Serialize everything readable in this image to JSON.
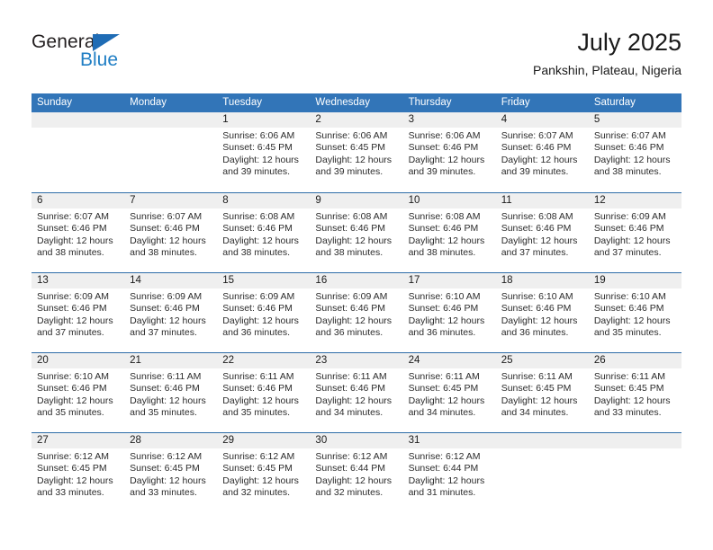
{
  "brand": {
    "name_top": "General",
    "name_bottom": "Blue",
    "accent_color": "#1f7ec4",
    "triangle_color": "#1f6cb5"
  },
  "header": {
    "title": "July 2025",
    "location": "Pankshin, Plateau, Nigeria"
  },
  "theme": {
    "header_row_bg": "#3275b8",
    "row_divider": "#2e6da8",
    "day_number_band": "#efefef",
    "text": "#2b2b2b"
  },
  "calendar": {
    "day_headers": [
      "Sunday",
      "Monday",
      "Tuesday",
      "Wednesday",
      "Thursday",
      "Friday",
      "Saturday"
    ],
    "weeks": [
      [
        {
          "day": "",
          "lines": []
        },
        {
          "day": "",
          "lines": []
        },
        {
          "day": "1",
          "lines": [
            "Sunrise: 6:06 AM",
            "Sunset: 6:45 PM",
            "Daylight: 12 hours",
            "and 39 minutes."
          ]
        },
        {
          "day": "2",
          "lines": [
            "Sunrise: 6:06 AM",
            "Sunset: 6:45 PM",
            "Daylight: 12 hours",
            "and 39 minutes."
          ]
        },
        {
          "day": "3",
          "lines": [
            "Sunrise: 6:06 AM",
            "Sunset: 6:46 PM",
            "Daylight: 12 hours",
            "and 39 minutes."
          ]
        },
        {
          "day": "4",
          "lines": [
            "Sunrise: 6:07 AM",
            "Sunset: 6:46 PM",
            "Daylight: 12 hours",
            "and 39 minutes."
          ]
        },
        {
          "day": "5",
          "lines": [
            "Sunrise: 6:07 AM",
            "Sunset: 6:46 PM",
            "Daylight: 12 hours",
            "and 38 minutes."
          ]
        }
      ],
      [
        {
          "day": "6",
          "lines": [
            "Sunrise: 6:07 AM",
            "Sunset: 6:46 PM",
            "Daylight: 12 hours",
            "and 38 minutes."
          ]
        },
        {
          "day": "7",
          "lines": [
            "Sunrise: 6:07 AM",
            "Sunset: 6:46 PM",
            "Daylight: 12 hours",
            "and 38 minutes."
          ]
        },
        {
          "day": "8",
          "lines": [
            "Sunrise: 6:08 AM",
            "Sunset: 6:46 PM",
            "Daylight: 12 hours",
            "and 38 minutes."
          ]
        },
        {
          "day": "9",
          "lines": [
            "Sunrise: 6:08 AM",
            "Sunset: 6:46 PM",
            "Daylight: 12 hours",
            "and 38 minutes."
          ]
        },
        {
          "day": "10",
          "lines": [
            "Sunrise: 6:08 AM",
            "Sunset: 6:46 PM",
            "Daylight: 12 hours",
            "and 38 minutes."
          ]
        },
        {
          "day": "11",
          "lines": [
            "Sunrise: 6:08 AM",
            "Sunset: 6:46 PM",
            "Daylight: 12 hours",
            "and 37 minutes."
          ]
        },
        {
          "day": "12",
          "lines": [
            "Sunrise: 6:09 AM",
            "Sunset: 6:46 PM",
            "Daylight: 12 hours",
            "and 37 minutes."
          ]
        }
      ],
      [
        {
          "day": "13",
          "lines": [
            "Sunrise: 6:09 AM",
            "Sunset: 6:46 PM",
            "Daylight: 12 hours",
            "and 37 minutes."
          ]
        },
        {
          "day": "14",
          "lines": [
            "Sunrise: 6:09 AM",
            "Sunset: 6:46 PM",
            "Daylight: 12 hours",
            "and 37 minutes."
          ]
        },
        {
          "day": "15",
          "lines": [
            "Sunrise: 6:09 AM",
            "Sunset: 6:46 PM",
            "Daylight: 12 hours",
            "and 36 minutes."
          ]
        },
        {
          "day": "16",
          "lines": [
            "Sunrise: 6:09 AM",
            "Sunset: 6:46 PM",
            "Daylight: 12 hours",
            "and 36 minutes."
          ]
        },
        {
          "day": "17",
          "lines": [
            "Sunrise: 6:10 AM",
            "Sunset: 6:46 PM",
            "Daylight: 12 hours",
            "and 36 minutes."
          ]
        },
        {
          "day": "18",
          "lines": [
            "Sunrise: 6:10 AM",
            "Sunset: 6:46 PM",
            "Daylight: 12 hours",
            "and 36 minutes."
          ]
        },
        {
          "day": "19",
          "lines": [
            "Sunrise: 6:10 AM",
            "Sunset: 6:46 PM",
            "Daylight: 12 hours",
            "and 35 minutes."
          ]
        }
      ],
      [
        {
          "day": "20",
          "lines": [
            "Sunrise: 6:10 AM",
            "Sunset: 6:46 PM",
            "Daylight: 12 hours",
            "and 35 minutes."
          ]
        },
        {
          "day": "21",
          "lines": [
            "Sunrise: 6:11 AM",
            "Sunset: 6:46 PM",
            "Daylight: 12 hours",
            "and 35 minutes."
          ]
        },
        {
          "day": "22",
          "lines": [
            "Sunrise: 6:11 AM",
            "Sunset: 6:46 PM",
            "Daylight: 12 hours",
            "and 35 minutes."
          ]
        },
        {
          "day": "23",
          "lines": [
            "Sunrise: 6:11 AM",
            "Sunset: 6:46 PM",
            "Daylight: 12 hours",
            "and 34 minutes."
          ]
        },
        {
          "day": "24",
          "lines": [
            "Sunrise: 6:11 AM",
            "Sunset: 6:45 PM",
            "Daylight: 12 hours",
            "and 34 minutes."
          ]
        },
        {
          "day": "25",
          "lines": [
            "Sunrise: 6:11 AM",
            "Sunset: 6:45 PM",
            "Daylight: 12 hours",
            "and 34 minutes."
          ]
        },
        {
          "day": "26",
          "lines": [
            "Sunrise: 6:11 AM",
            "Sunset: 6:45 PM",
            "Daylight: 12 hours",
            "and 33 minutes."
          ]
        }
      ],
      [
        {
          "day": "27",
          "lines": [
            "Sunrise: 6:12 AM",
            "Sunset: 6:45 PM",
            "Daylight: 12 hours",
            "and 33 minutes."
          ]
        },
        {
          "day": "28",
          "lines": [
            "Sunrise: 6:12 AM",
            "Sunset: 6:45 PM",
            "Daylight: 12 hours",
            "and 33 minutes."
          ]
        },
        {
          "day": "29",
          "lines": [
            "Sunrise: 6:12 AM",
            "Sunset: 6:45 PM",
            "Daylight: 12 hours",
            "and 32 minutes."
          ]
        },
        {
          "day": "30",
          "lines": [
            "Sunrise: 6:12 AM",
            "Sunset: 6:44 PM",
            "Daylight: 12 hours",
            "and 32 minutes."
          ]
        },
        {
          "day": "31",
          "lines": [
            "Sunrise: 6:12 AM",
            "Sunset: 6:44 PM",
            "Daylight: 12 hours",
            "and 31 minutes."
          ]
        },
        {
          "day": "",
          "lines": []
        },
        {
          "day": "",
          "lines": []
        }
      ]
    ]
  }
}
